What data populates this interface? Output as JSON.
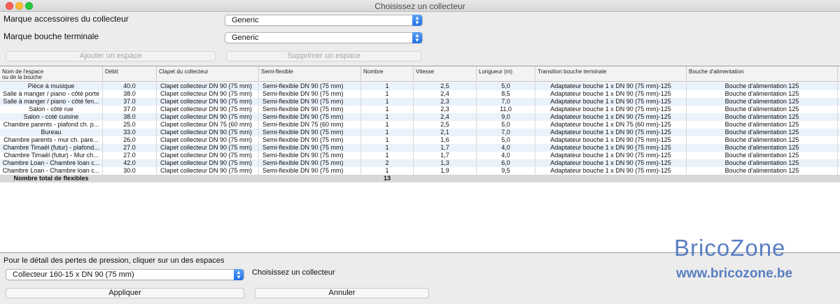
{
  "window": {
    "title": "Choisissez un collecteur"
  },
  "top": {
    "accessories_label": "Marque accessoires du collecteur",
    "accessories_value": "Generic",
    "terminal_label": "Marque bouche terminale",
    "terminal_value": "Generic",
    "add_space": "Ajouter un espace",
    "remove_space": "Supprimer un espace"
  },
  "table": {
    "headers": [
      "Nom de l'espace\nou de la bouche",
      "Débit",
      "Clapet du collecteur",
      "Semi-flexible",
      "Nombre",
      "Vitesse",
      "Longueur (m)",
      "Transition bouche terminale",
      "Bouche d'alimentation"
    ],
    "rows": [
      [
        "Pièce à musique",
        "40.0",
        "Clapet collecteur DN 90 (75 mm)",
        "Semi-flexible DN 90 (75 mm)",
        "1",
        "2,5",
        "5,0",
        "Adaptateur bouche 1 x  DN 90 (75 mm)-125",
        "Bouche d'alimentation 125"
      ],
      [
        "Salle à manger / piano - côté porte",
        "38.0",
        "Clapet collecteur DN 90 (75 mm)",
        "Semi-flexible DN 90 (75 mm)",
        "1",
        "2,4",
        "8,5",
        "Adaptateur bouche 1 x  DN 90 (75 mm)-125",
        "Bouche d'alimentation 125"
      ],
      [
        "Salle à manger / piano - côté fen...",
        "37.0",
        "Clapet collecteur DN 90 (75 mm)",
        "Semi-flexible DN 90 (75 mm)",
        "1",
        "2,3",
        "7,0",
        "Adaptateur bouche 1 x  DN 90 (75 mm)-125",
        "Bouche d'alimentation 125"
      ],
      [
        "Salon - côté rue",
        "37.0",
        "Clapet collecteur DN 90 (75 mm)",
        "Semi-flexible DN 90 (75 mm)",
        "1",
        "2,3",
        "11,0",
        "Adaptateur bouche 1 x  DN 90 (75 mm)-125",
        "Bouche d'alimentation 125"
      ],
      [
        "Salon - coté cuisine",
        "38.0",
        "Clapet collecteur DN 90 (75 mm)",
        "Semi-flexible DN 90 (75 mm)",
        "1",
        "2,4",
        "9,0",
        "Adaptateur bouche 1 x  DN 90 (75 mm)-125",
        "Bouche d'alimentation 125"
      ],
      [
        "Chambre parents - plafond ch. p...",
        "25.0",
        "Clapet collecteur DN 75 (60 mm)",
        "Semi-flexible DN 75 (60 mm)",
        "1",
        "2,5",
        "5,0",
        "Adaptateur bouche 1 x DN 75 (60 mm)-125",
        "Bouche d'alimentation 125"
      ],
      [
        "Bureau",
        "33.0",
        "Clapet collecteur DN 90 (75 mm)",
        "Semi-flexible DN 90 (75 mm)",
        "1",
        "2,1",
        "7,0",
        "Adaptateur bouche 1 x  DN 90 (75 mm)-125",
        "Bouche d'alimentation 125"
      ],
      [
        "Chambre parents - mur ch. pare...",
        "26.0",
        "Clapet collecteur DN 90 (75 mm)",
        "Semi-flexible DN 90 (75 mm)",
        "1",
        "1,6",
        "5,0",
        "Adaptateur bouche 1 x  DN 90 (75 mm)-125",
        "Bouche d'alimentation 125"
      ],
      [
        "Chambre Timaël (futur) - plafond...",
        "27.0",
        "Clapet collecteur DN 90 (75 mm)",
        "Semi-flexible DN 90 (75 mm)",
        "1",
        "1,7",
        "4,0",
        "Adaptateur bouche 1 x  DN 90 (75 mm)-125",
        "Bouche d'alimentation 125"
      ],
      [
        "Chambre Timaël (futur) - Mur ch...",
        "27.0",
        "Clapet collecteur DN 90 (75 mm)",
        "Semi-flexible DN 90 (75 mm)",
        "1",
        "1,7",
        "4,0",
        "Adaptateur bouche 1 x  DN 90 (75 mm)-125",
        "Bouche d'alimentation 125"
      ],
      [
        "Chambre Loan - Chambre loan c...",
        "42.0",
        "Clapet collecteur DN 90 (75 mm)",
        "Semi-flexible DN 90 (75 mm)",
        "2",
        "1,3",
        "6,0",
        "Adaptateur bouche 1 x  DN 90 (75 mm)-125",
        "Bouche d'alimentation 125"
      ],
      [
        "Chambre Loan - Chambre loan c...",
        "30.0",
        "Clapet collecteur DN 90 (75 mm)",
        "Semi-flexible DN 90 (75 mm)",
        "1",
        "1,9",
        "9,5",
        "Adaptateur bouche 1 x  DN 90 (75 mm)-125",
        "Bouche d'alimentation 125"
      ]
    ],
    "total_label": "Nombre total de flexibles",
    "total_value": "13"
  },
  "bottom": {
    "hint": "Pour le détail des pertes de pression, cliquer sur un des espaces",
    "collector_value": "Collecteur 160-15 x DN 90 (75 mm)",
    "collector_label": "Choisissez un collecteur",
    "apply": "Appliquer",
    "cancel": "Annuler"
  },
  "watermark": {
    "title": "BricoZone",
    "url": "www.bricozone.be"
  },
  "colors": {
    "row_alt": "#eaf2fb",
    "select_accent": "#1f6fe5",
    "watermark": "#5a7fc1"
  }
}
